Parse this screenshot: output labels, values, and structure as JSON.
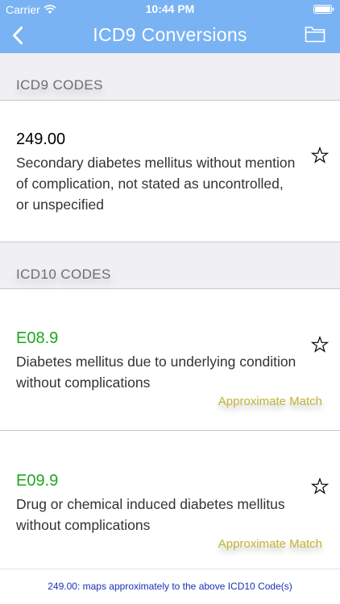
{
  "status_bar": {
    "carrier": "Carrier",
    "time": "10:44 PM"
  },
  "nav": {
    "title": "ICD9 Conversions",
    "back_icon": "chevron-left-icon",
    "folder_icon": "folder-icon"
  },
  "icd9_section": {
    "label": "ICD9 CODES",
    "items": [
      {
        "code": "249.00",
        "description_lines": [
          "Secondary diabetes mellitus without mention",
          "of complication, not stated as uncontrolled,",
          "or unspecified"
        ]
      }
    ]
  },
  "icd10_section": {
    "label": "ICD10 CODES",
    "items": [
      {
        "code": "E08.9",
        "description_lines": [
          "Diabetes mellitus due to underlying condition",
          "without complications"
        ],
        "match": "Approximate Match"
      },
      {
        "code": "E09.9",
        "description_lines": [
          "Drug or chemical induced diabetes mellitus",
          "without complications"
        ],
        "match": "Approximate Match"
      }
    ]
  },
  "footer": {
    "text": "249.00: maps approximately to the above ICD10 Code(s)"
  },
  "colors": {
    "header": "#7ab3f3",
    "icd10_code": "#1fa61f",
    "match": "#c0b533",
    "footer_text": "#1a2fb8",
    "section_bg": "#efeff4"
  }
}
